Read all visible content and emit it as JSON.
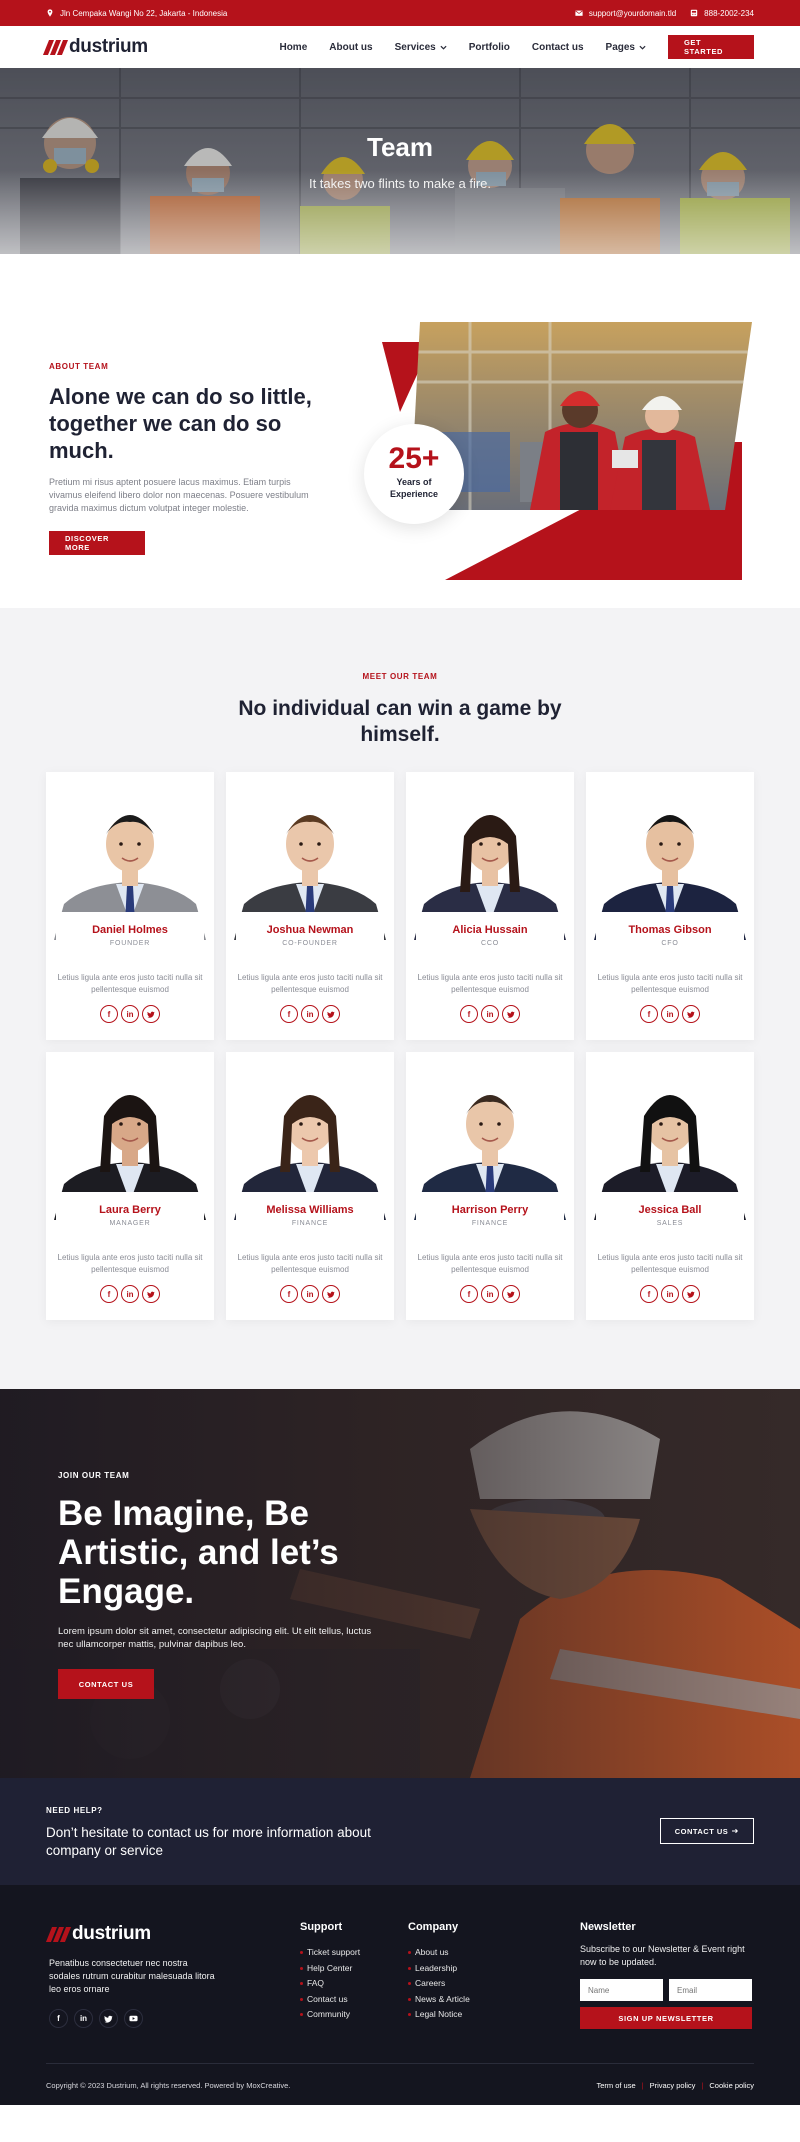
{
  "topbar": {
    "address": "Jln Cempaka Wangi No 22, Jakarta - Indonesia",
    "email": "support@yourdomain.tld",
    "phone": "888-2002-234"
  },
  "brand": {
    "name": "dustrium",
    "accent": "#b5121b",
    "dark": "#1f2134"
  },
  "nav": {
    "items": [
      "Home",
      "About us",
      "Services",
      "Portfolio",
      "Contact us",
      "Pages"
    ],
    "cta": "GET STARTED"
  },
  "hero": {
    "title": "Team",
    "subtitle": "It takes two flints to make a fire."
  },
  "about": {
    "eyebrow": "ABOUT TEAM",
    "title": "Alone we can do so little, together we can do so much.",
    "text": "Pretium mi risus aptent posuere lacus maximus. Etiam turpis vivamus eleifend libero dolor non maecenas. Posuere vestibulum gravida maximus dictum volutpat integer molestie.",
    "button": "DISCOVER MORE",
    "experience_number": "25+",
    "experience_label": "Years of Experience"
  },
  "team": {
    "eyebrow": "MEET OUR TEAM",
    "title": "No individual can win a game by himself.",
    "card_text": "Letius ligula ante eros justo taciti nulla sit pellentesque euismod",
    "social_icons": [
      "facebook-icon",
      "linkedin-icon",
      "twitter-icon"
    ],
    "members": [
      {
        "name": "Daniel Holmes",
        "role": "FOUNDER"
      },
      {
        "name": "Joshua Newman",
        "role": "CO-FOUNDER"
      },
      {
        "name": "Alicia Hussain",
        "role": "CCO"
      },
      {
        "name": "Thomas Gibson",
        "role": "CFO"
      },
      {
        "name": "Laura Berry",
        "role": "MANAGER"
      },
      {
        "name": "Melissa Williams",
        "role": "FINANCE"
      },
      {
        "name": "Harrison Perry",
        "role": "FINANCE"
      },
      {
        "name": "Jessica Ball",
        "role": "SALES"
      }
    ]
  },
  "join": {
    "eyebrow": "JOIN OUR TEAM",
    "title": "Be Imagine, Be Artistic, and let’s Engage.",
    "text": "Lorem ipsum dolor sit amet, consectetur adipiscing elit. Ut elit tellus, luctus nec ullamcorper mattis, pulvinar dapibus leo.",
    "button": "CONTACT US"
  },
  "help": {
    "eyebrow": "NEED HELP?",
    "text": "Don’t hesitate to contact us for more information about company or service",
    "button": "CONTACT US"
  },
  "footer": {
    "about": "Penatibus consectetuer nec nostra sodales rutrum curabitur malesuada litora leo eros ornare",
    "support_title": "Support",
    "support_links": [
      "Ticket support",
      "Help Center",
      "FAQ",
      "Contact us",
      "Community"
    ],
    "company_title": "Company",
    "company_links": [
      "About us",
      "Leadership",
      "Careers",
      "News & Article",
      "Legal Notice"
    ],
    "newsletter_title": "Newsletter",
    "newsletter_text": "Subscribe to our Newsletter & Event right now to be updated.",
    "name_placeholder": "Name",
    "email_placeholder": "Email",
    "subscribe_button": "SIGN UP NEWSLETTER",
    "copyright": "Copyright © 2023 Dustrium, All rights reserved. Powered by MoxCreative.",
    "legal_links": [
      "Term of use",
      "Privacy policy",
      "Cookie policy"
    ]
  }
}
